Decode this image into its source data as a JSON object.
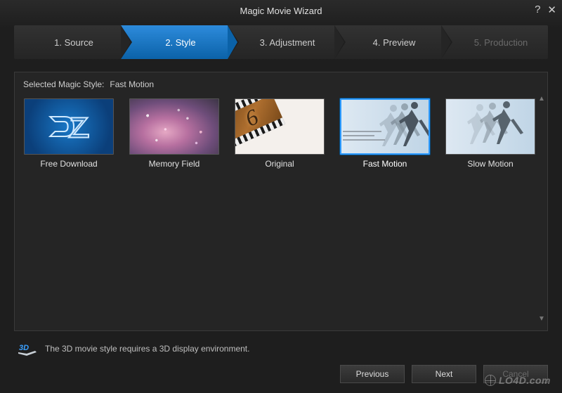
{
  "window": {
    "title": "Magic Movie Wizard"
  },
  "steps": [
    {
      "label": "1. Source",
      "state": "normal"
    },
    {
      "label": "2. Style",
      "state": "active"
    },
    {
      "label": "3. Adjustment",
      "state": "normal"
    },
    {
      "label": "4. Preview",
      "state": "normal"
    },
    {
      "label": "5. Production",
      "state": "disabled"
    }
  ],
  "panel": {
    "selected_label": "Selected Magic Style:",
    "selected_value": "Fast Motion"
  },
  "styles": [
    {
      "label": "Free Download",
      "selected": false,
      "thumb": "dz"
    },
    {
      "label": "Memory Field",
      "selected": false,
      "thumb": "mem"
    },
    {
      "label": "Original",
      "selected": false,
      "thumb": "orig",
      "frame_number": "6"
    },
    {
      "label": "Fast Motion",
      "selected": true,
      "thumb": "fast"
    },
    {
      "label": "Slow Motion",
      "selected": false,
      "thumb": "slow"
    }
  ],
  "hint": {
    "text": "The 3D movie style requires a 3D display environment.",
    "badge": "3D"
  },
  "buttons": {
    "previous": "Previous",
    "next": "Next",
    "cancel": "Cancel"
  },
  "watermark": "LO4D.com"
}
